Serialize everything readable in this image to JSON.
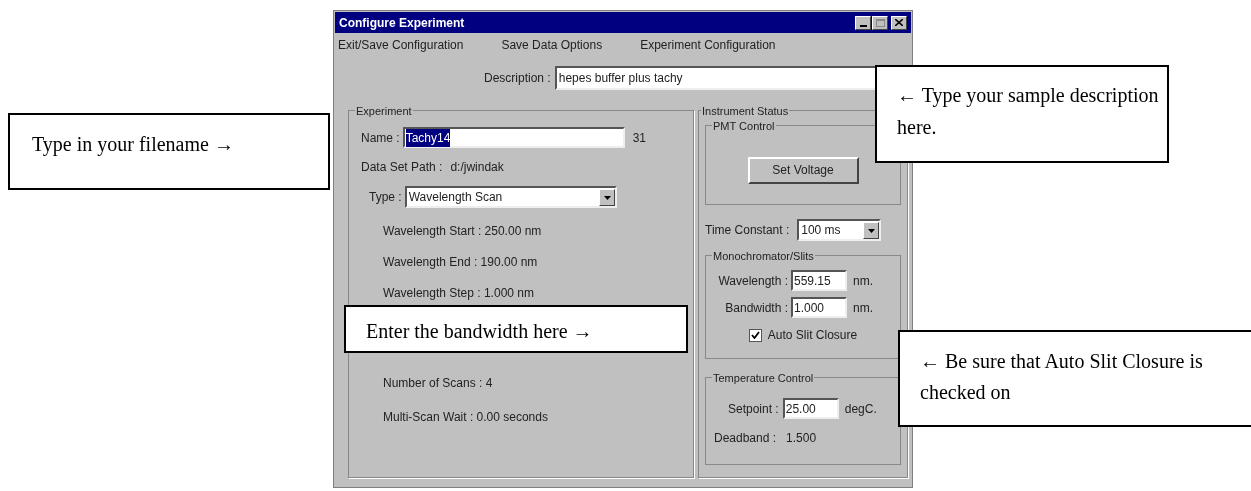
{
  "window": {
    "title": "Configure Experiment"
  },
  "menu": [
    "Exit/Save Configuration",
    "Save Data Options",
    "Experiment Configuration"
  ],
  "description": {
    "label": "Description :",
    "value": "hepes buffer plus tachy"
  },
  "experiment": {
    "title": "Experiment",
    "name": {
      "label": "Name :",
      "value": "Tachy14",
      "selected": true,
      "count": "31"
    },
    "path": {
      "label": "Data Set Path :",
      "value": "d:/jwindak"
    },
    "type": {
      "label": "Type :",
      "value": "Wavelength Scan"
    },
    "params_top": [
      "Wavelength Start : 250.00 nm",
      "Wavelength End : 190.00 nm",
      "Wavelength Step : 1.000 nm"
    ],
    "params_bottom": [
      "Number of Scans : 4",
      "Multi-Scan Wait :  0.00 seconds"
    ]
  },
  "instrument_status": {
    "title": "Instrument Status",
    "pmt": {
      "title": "PMT Control",
      "button": "Set Voltage"
    },
    "time_constant": {
      "label": "Time Constant :",
      "value": "100 ms"
    },
    "mono": {
      "title": "Monochromator/Slits",
      "fields": [
        {
          "label": "Wavelength :",
          "value": "559.15",
          "unit": "nm."
        },
        {
          "label": "Bandwidth :",
          "value": "1.000",
          "unit": "nm."
        }
      ],
      "auto_slit": {
        "label": "Auto Slit Closure",
        "checked": true
      }
    },
    "temperature": {
      "title": "Temperature Control",
      "setpoint": {
        "label": "Setpoint :",
        "value": "25.00",
        "unit": "degC."
      },
      "deadband": {
        "label": "Deadband :",
        "value": "1.500"
      }
    }
  },
  "callouts": [
    "Type in your filename **→**",
    "**←** Type your sample description here.",
    "Enter the bandwidth here **→**",
    "**←** Be sure that Auto Slit Closure is checked on"
  ]
}
